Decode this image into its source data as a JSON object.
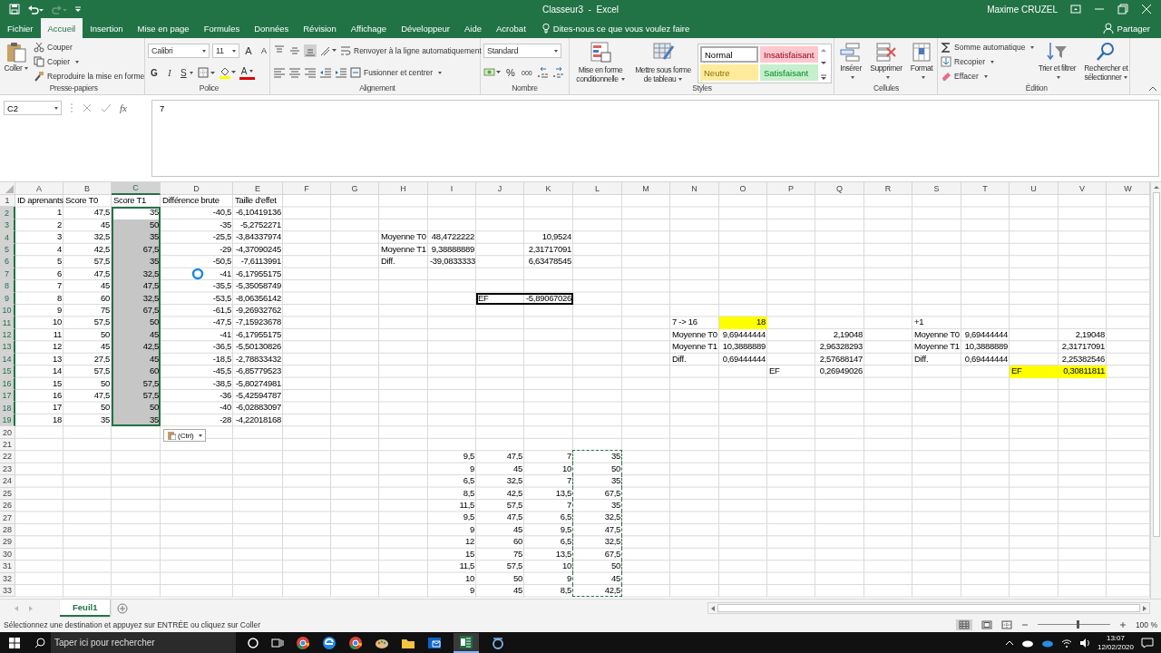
{
  "title_bar": {
    "title": "Classeur3  -  Excel",
    "user": "Maxime CRUZEL"
  },
  "ribbon_tabs": [
    {
      "label": "Fichier",
      "selected": false
    },
    {
      "label": "Accueil",
      "selected": true
    },
    {
      "label": "Insertion",
      "selected": false
    },
    {
      "label": "Mise en page",
      "selected": false
    },
    {
      "label": "Formules",
      "selected": false
    },
    {
      "label": "Données",
      "selected": false
    },
    {
      "label": "Révision",
      "selected": false
    },
    {
      "label": "Affichage",
      "selected": false
    },
    {
      "label": "Développeur",
      "selected": false
    },
    {
      "label": "Aide",
      "selected": false
    },
    {
      "label": "Acrobat",
      "selected": false
    }
  ],
  "tell_me": "Dites-nous ce que vous voulez faire",
  "share": "Partager",
  "ribbon_groups": [
    {
      "label": "Presse-papiers",
      "texts": [
        "Coller",
        "Couper",
        "Copier",
        "Reproduire la mise en forme"
      ]
    },
    {
      "label": "Police",
      "texts": [
        "Calibri",
        "11",
        "A",
        "A",
        "G",
        "I",
        "S",
        "A"
      ]
    },
    {
      "label": "Alignement",
      "texts": [
        "Renvoyer à la ligne automatiquement",
        "Fusionner et centrer"
      ]
    },
    {
      "label": "Nombre",
      "texts": [
        "Standard",
        "%",
        "000"
      ]
    },
    {
      "label": "Styles",
      "texts": [
        "Mise en forme conditionnelle",
        "Mettre sous forme de tableau"
      ],
      "styles": [
        {
          "label": "Normal",
          "color": "#ffffff",
          "selected": true
        },
        {
          "label": "Insatisfaisant",
          "color": "#ffc7ce",
          "selected": false
        },
        {
          "label": "Neutre",
          "color": "#ffeb9c",
          "selected": false
        },
        {
          "label": "Satisfaisant",
          "color": "#c6efce",
          "selected": false
        }
      ]
    },
    {
      "label": "Cellules",
      "texts": [
        "Insérer",
        "Supprimer",
        "Format"
      ]
    },
    {
      "label": "Édition",
      "texts": [
        "Somme automatique",
        "Recopier",
        "Effacer",
        "Trier et filtrer",
        "Rechercher et sélectionner"
      ]
    }
  ],
  "formula_bar": {
    "name_box": "C2",
    "function_label": "fx",
    "value": "7"
  },
  "sheet": {
    "columns": [
      "A",
      "B",
      "C",
      "D",
      "E",
      "F",
      "G",
      "H",
      "I",
      "J",
      "K",
      "L",
      "M",
      "N",
      "O",
      "P",
      "Q",
      "R",
      "S",
      "T",
      "U",
      "V",
      "W"
    ],
    "rows": [
      {
        "number": "1",
        "cells": {
          "A": {
            "text": "ID aprenants",
            "kind": "text",
            "selected": false
          },
          "B": {
            "text": "Score T0",
            "kind": "text",
            "selected": false
          },
          "C": {
            "text": "Score T1",
            "kind": "text",
            "selected": false
          },
          "D": {
            "text": "Différence brute",
            "kind": "text",
            "selected": false
          },
          "E": {
            "text": "Taille d'effet",
            "kind": "text",
            "selected": false
          }
        }
      },
      {
        "number": "2",
        "cells": {
          "A": {
            "text": "1",
            "kind": "number",
            "selected": false
          },
          "B": {
            "text": "47,5",
            "kind": "number",
            "selected": false
          },
          "C": {
            "text": "35",
            "kind": "number",
            "selected": true,
            "active": true
          },
          "D": {
            "text": "-40,5",
            "kind": "number",
            "selected": false
          },
          "E": {
            "text": "-6,10419136",
            "kind": "number",
            "selected": false
          }
        }
      },
      {
        "number": "3",
        "cells": {
          "A": {
            "text": "2",
            "kind": "number",
            "selected": false
          },
          "B": {
            "text": "45",
            "kind": "number",
            "selected": false
          },
          "C": {
            "text": "50",
            "kind": "number",
            "selected": true
          },
          "D": {
            "text": "-35",
            "kind": "number",
            "selected": false
          },
          "E": {
            "text": "-5,2752271",
            "kind": "number",
            "selected": false
          }
        }
      },
      {
        "number": "4",
        "cells": {
          "A": {
            "text": "3",
            "kind": "number",
            "selected": false
          },
          "B": {
            "text": "32,5",
            "kind": "number",
            "selected": false
          },
          "C": {
            "text": "35",
            "kind": "number",
            "selected": true
          },
          "D": {
            "text": "-25,5",
            "kind": "number",
            "selected": false
          },
          "E": {
            "text": "-3,84337974",
            "kind": "number",
            "selected": false
          },
          "H": {
            "text": "Moyenne T0",
            "kind": "text",
            "selected": false
          },
          "I": {
            "text": "48,4722222",
            "kind": "number",
            "selected": false
          },
          "K": {
            "text": "10,9524",
            "kind": "number",
            "selected": false
          }
        }
      },
      {
        "number": "5",
        "cells": {
          "A": {
            "text": "4",
            "kind": "number",
            "selected": false
          },
          "B": {
            "text": "42,5",
            "kind": "number",
            "selected": false
          },
          "C": {
            "text": "67,5",
            "kind": "number",
            "selected": true
          },
          "D": {
            "text": "-29",
            "kind": "number",
            "selected": false
          },
          "E": {
            "text": "-4,37090245",
            "kind": "number",
            "selected": false
          },
          "H": {
            "text": "Moyenne T1",
            "kind": "text",
            "selected": false
          },
          "I": {
            "text": "9,38888889",
            "kind": "number",
            "selected": false
          },
          "K": {
            "text": "2,31717091",
            "kind": "number",
            "selected": false
          }
        }
      },
      {
        "number": "6",
        "cells": {
          "A": {
            "text": "5",
            "kind": "number",
            "selected": false
          },
          "B": {
            "text": "57,5",
            "kind": "number",
            "selected": false
          },
          "C": {
            "text": "35",
            "kind": "number",
            "selected": true
          },
          "D": {
            "text": "-50,5",
            "kind": "number",
            "selected": false
          },
          "E": {
            "text": "-7,6113991",
            "kind": "number",
            "selected": false
          },
          "H": {
            "text": "Diff.",
            "kind": "text",
            "selected": false
          },
          "I": {
            "text": "-39,0833333",
            "kind": "number",
            "selected": false
          },
          "K": {
            "text": "6,63478545",
            "kind": "number",
            "selected": false
          }
        }
      },
      {
        "number": "7",
        "cells": {
          "A": {
            "text": "6",
            "kind": "number",
            "selected": false
          },
          "B": {
            "text": "47,5",
            "kind": "number",
            "selected": false
          },
          "C": {
            "text": "32,5",
            "kind": "number",
            "selected": true
          },
          "D": {
            "text": "-41",
            "kind": "number",
            "selected": false
          },
          "E": {
            "text": "-6,17955175",
            "kind": "number",
            "selected": false
          }
        }
      },
      {
        "number": "8",
        "cells": {
          "A": {
            "text": "7",
            "kind": "number",
            "selected": false
          },
          "B": {
            "text": "45",
            "kind": "number",
            "selected": false
          },
          "C": {
            "text": "47,5",
            "kind": "number",
            "selected": true
          },
          "D": {
            "text": "-35,5",
            "kind": "number",
            "selected": false
          },
          "E": {
            "text": "-5,35058749",
            "kind": "number",
            "selected": false
          }
        }
      },
      {
        "number": "9",
        "cells": {
          "A": {
            "text": "8",
            "kind": "number",
            "selected": false
          },
          "B": {
            "text": "60",
            "kind": "number",
            "selected": false
          },
          "C": {
            "text": "32,5",
            "kind": "number",
            "selected": true
          },
          "D": {
            "text": "-53,5",
            "kind": "number",
            "selected": false
          },
          "E": {
            "text": "-8,06356142",
            "kind": "number",
            "selected": false
          },
          "J": {
            "text": "EF",
            "kind": "text",
            "selected": false,
            "outlined": true
          },
          "K": {
            "text": "-5,89067026",
            "kind": "number",
            "selected": false,
            "outlined": true
          }
        }
      },
      {
        "number": "10",
        "cells": {
          "A": {
            "text": "9",
            "kind": "number",
            "selected": false
          },
          "B": {
            "text": "75",
            "kind": "number",
            "selected": false
          },
          "C": {
            "text": "67,5",
            "kind": "number",
            "selected": true
          },
          "D": {
            "text": "-61,5",
            "kind": "number",
            "selected": false
          },
          "E": {
            "text": "-9,26932762",
            "kind": "number",
            "selected": false
          }
        }
      },
      {
        "number": "11",
        "cells": {
          "A": {
            "text": "10",
            "kind": "number",
            "selected": false
          },
          "B": {
            "text": "57,5",
            "kind": "number",
            "selected": false
          },
          "C": {
            "text": "50",
            "kind": "number",
            "selected": true
          },
          "D": {
            "text": "-47,5",
            "kind": "number",
            "selected": false
          },
          "E": {
            "text": "-7,15923678",
            "kind": "number",
            "selected": false
          },
          "N": {
            "text": "7 -> 16",
            "kind": "text",
            "selected": false
          },
          "O": {
            "text": "18",
            "kind": "number",
            "selected": false,
            "color": "#ffff00"
          },
          "S": {
            "text": "+1",
            "kind": "text",
            "selected": false
          }
        }
      },
      {
        "number": "12",
        "cells": {
          "A": {
            "text": "11",
            "kind": "number",
            "selected": false
          },
          "B": {
            "text": "50",
            "kind": "number",
            "selected": false
          },
          "C": {
            "text": "45",
            "kind": "number",
            "selected": true
          },
          "D": {
            "text": "-41",
            "kind": "number",
            "selected": false
          },
          "E": {
            "text": "-6,17955175",
            "kind": "number",
            "selected": false
          },
          "N": {
            "text": "Moyenne T0",
            "kind": "text",
            "selected": false
          },
          "O": {
            "text": "9,69444444",
            "kind": "number",
            "selected": false
          },
          "Q": {
            "text": "2,19048",
            "kind": "number",
            "selected": false
          },
          "S": {
            "text": "Moyenne T0",
            "kind": "text",
            "selected": false
          },
          "T": {
            "text": "9,69444444",
            "kind": "number",
            "selected": false
          },
          "V": {
            "text": "2,19048",
            "kind": "number",
            "selected": false
          }
        }
      },
      {
        "number": "13",
        "cells": {
          "A": {
            "text": "12",
            "kind": "number",
            "selected": false
          },
          "B": {
            "text": "45",
            "kind": "number",
            "selected": false
          },
          "C": {
            "text": "42,5",
            "kind": "number",
            "selected": true
          },
          "D": {
            "text": "-36,5",
            "kind": "number",
            "selected": false
          },
          "E": {
            "text": "-5,50130826",
            "kind": "number",
            "selected": false
          },
          "N": {
            "text": "Moyenne T1",
            "kind": "text",
            "selected": false
          },
          "O": {
            "text": "10,3888889",
            "kind": "number",
            "selected": false
          },
          "Q": {
            "text": "2,96328293",
            "kind": "number",
            "selected": false
          },
          "S": {
            "text": "Moyenne T1",
            "kind": "text",
            "selected": false
          },
          "T": {
            "text": "10,3888889",
            "kind": "number",
            "selected": false
          },
          "V": {
            "text": "2,31717091",
            "kind": "number",
            "selected": false
          }
        }
      },
      {
        "number": "14",
        "cells": {
          "A": {
            "text": "13",
            "kind": "number",
            "selected": false
          },
          "B": {
            "text": "27,5",
            "kind": "number",
            "selected": false
          },
          "C": {
            "text": "45",
            "kind": "number",
            "selected": true
          },
          "D": {
            "text": "-18,5",
            "kind": "number",
            "selected": false
          },
          "E": {
            "text": "-2,78833432",
            "kind": "number",
            "selected": false
          },
          "N": {
            "text": "Diff.",
            "kind": "text",
            "selected": false
          },
          "O": {
            "text": "0,69444444",
            "kind": "number",
            "selected": false
          },
          "Q": {
            "text": "2,57688147",
            "kind": "number",
            "selected": false
          },
          "S": {
            "text": "Diff.",
            "kind": "text",
            "selected": false
          },
          "T": {
            "text": "0,69444444",
            "kind": "number",
            "selected": false
          },
          "V": {
            "text": "2,25382546",
            "kind": "number",
            "selected": false
          }
        }
      },
      {
        "number": "15",
        "cells": {
          "A": {
            "text": "14",
            "kind": "number",
            "selected": false
          },
          "B": {
            "text": "57,5",
            "kind": "number",
            "selected": false
          },
          "C": {
            "text": "60",
            "kind": "number",
            "selected": true
          },
          "D": {
            "text": "-45,5",
            "kind": "number",
            "selected": false
          },
          "E": {
            "text": "-6,85779523",
            "kind": "number",
            "selected": false
          },
          "P": {
            "text": "EF",
            "kind": "text",
            "selected": false
          },
          "Q": {
            "text": "0,26949026",
            "kind": "number",
            "selected": false
          },
          "U": {
            "text": "EF",
            "kind": "text",
            "selected": false,
            "color": "#ffff00"
          },
          "V": {
            "text": "0,30811811",
            "kind": "number",
            "selected": false,
            "color": "#ffff00"
          }
        }
      },
      {
        "number": "16",
        "cells": {
          "A": {
            "text": "15",
            "kind": "number",
            "selected": false
          },
          "B": {
            "text": "50",
            "kind": "number",
            "selected": false
          },
          "C": {
            "text": "57,5",
            "kind": "number",
            "selected": true
          },
          "D": {
            "text": "-38,5",
            "kind": "number",
            "selected": false
          },
          "E": {
            "text": "-5,80274981",
            "kind": "number",
            "selected": false
          }
        }
      },
      {
        "number": "17",
        "cells": {
          "A": {
            "text": "16",
            "kind": "number",
            "selected": false
          },
          "B": {
            "text": "47,5",
            "kind": "number",
            "selected": false
          },
          "C": {
            "text": "57,5",
            "kind": "number",
            "selected": true
          },
          "D": {
            "text": "-36",
            "kind": "number",
            "selected": false
          },
          "E": {
            "text": "-5,42594787",
            "kind": "number",
            "selected": false
          }
        }
      },
      {
        "number": "18",
        "cells": {
          "A": {
            "text": "17",
            "kind": "number",
            "selected": false
          },
          "B": {
            "text": "50",
            "kind": "number",
            "selected": false
          },
          "C": {
            "text": "50",
            "kind": "number",
            "selected": true
          },
          "D": {
            "text": "-40",
            "kind": "number",
            "selected": false
          },
          "E": {
            "text": "-6,02883097",
            "kind": "number",
            "selected": false
          }
        }
      },
      {
        "number": "19",
        "cells": {
          "A": {
            "text": "18",
            "kind": "number",
            "selected": false
          },
          "B": {
            "text": "35",
            "kind": "number",
            "selected": false
          },
          "C": {
            "text": "35",
            "kind": "number",
            "selected": true
          },
          "D": {
            "text": "-28",
            "kind": "number",
            "selected": false
          },
          "E": {
            "text": "-4,22018168",
            "kind": "number",
            "selected": false
          }
        }
      },
      {
        "number": "20"
      },
      {
        "number": "21"
      },
      {
        "number": "22",
        "cells": {
          "I": {
            "text": "9,5",
            "kind": "number",
            "selected": false
          },
          "J": {
            "text": "47,5",
            "kind": "number",
            "selected": false
          },
          "K": {
            "text": "7",
            "kind": "number",
            "selected": false
          },
          "L": {
            "text": "35",
            "kind": "number",
            "selected": false,
            "copied": true
          }
        }
      },
      {
        "number": "23",
        "cells": {
          "I": {
            "text": "9",
            "kind": "number",
            "selected": false
          },
          "J": {
            "text": "45",
            "kind": "number",
            "selected": false
          },
          "K": {
            "text": "10",
            "kind": "number",
            "selected": false
          },
          "L": {
            "text": "50",
            "kind": "number",
            "selected": false,
            "copied": true
          }
        }
      },
      {
        "number": "24",
        "cells": {
          "I": {
            "text": "6,5",
            "kind": "number",
            "selected": false
          },
          "J": {
            "text": "32,5",
            "kind": "number",
            "selected": false
          },
          "K": {
            "text": "7",
            "kind": "number",
            "selected": false
          },
          "L": {
            "text": "35",
            "kind": "number",
            "selected": false,
            "copied": true
          }
        }
      },
      {
        "number": "25",
        "cells": {
          "I": {
            "text": "8,5",
            "kind": "number",
            "selected": false
          },
          "J": {
            "text": "42,5",
            "kind": "number",
            "selected": false
          },
          "K": {
            "text": "13,5",
            "kind": "number",
            "selected": false
          },
          "L": {
            "text": "67,5",
            "kind": "number",
            "selected": false,
            "copied": true
          }
        }
      },
      {
        "number": "26",
        "cells": {
          "I": {
            "text": "11,5",
            "kind": "number",
            "selected": false
          },
          "J": {
            "text": "57,5",
            "kind": "number",
            "selected": false
          },
          "K": {
            "text": "7",
            "kind": "number",
            "selected": false
          },
          "L": {
            "text": "35",
            "kind": "number",
            "selected": false,
            "copied": true
          }
        }
      },
      {
        "number": "27",
        "cells": {
          "I": {
            "text": "9,5",
            "kind": "number",
            "selected": false
          },
          "J": {
            "text": "47,5",
            "kind": "number",
            "selected": false
          },
          "K": {
            "text": "6,5",
            "kind": "number",
            "selected": false
          },
          "L": {
            "text": "32,5",
            "kind": "number",
            "selected": false,
            "copied": true
          }
        }
      },
      {
        "number": "28",
        "cells": {
          "I": {
            "text": "9",
            "kind": "number",
            "selected": false
          },
          "J": {
            "text": "45",
            "kind": "number",
            "selected": false
          },
          "K": {
            "text": "9,5",
            "kind": "number",
            "selected": false
          },
          "L": {
            "text": "47,5",
            "kind": "number",
            "selected": false,
            "copied": true
          }
        }
      },
      {
        "number": "29",
        "cells": {
          "I": {
            "text": "12",
            "kind": "number",
            "selected": false
          },
          "J": {
            "text": "60",
            "kind": "number",
            "selected": false
          },
          "K": {
            "text": "6,5",
            "kind": "number",
            "selected": false
          },
          "L": {
            "text": "32,5",
            "kind": "number",
            "selected": false,
            "copied": true
          }
        }
      },
      {
        "number": "30",
        "cells": {
          "I": {
            "text": "15",
            "kind": "number",
            "selected": false
          },
          "J": {
            "text": "75",
            "kind": "number",
            "selected": false
          },
          "K": {
            "text": "13,5",
            "kind": "number",
            "selected": false
          },
          "L": {
            "text": "67,5",
            "kind": "number",
            "selected": false,
            "copied": true
          }
        }
      },
      {
        "number": "31",
        "cells": {
          "I": {
            "text": "11,5",
            "kind": "number",
            "selected": false
          },
          "J": {
            "text": "57,5",
            "kind": "number",
            "selected": false
          },
          "K": {
            "text": "10",
            "kind": "number",
            "selected": false
          },
          "L": {
            "text": "50",
            "kind": "number",
            "selected": false,
            "copied": true
          }
        }
      },
      {
        "number": "32",
        "cells": {
          "I": {
            "text": "10",
            "kind": "number",
            "selected": false
          },
          "J": {
            "text": "50",
            "kind": "number",
            "selected": false
          },
          "K": {
            "text": "9",
            "kind": "number",
            "selected": false
          },
          "L": {
            "text": "45",
            "kind": "number",
            "selected": false,
            "copied": true
          }
        }
      },
      {
        "number": "33",
        "cells": {
          "I": {
            "text": "9",
            "kind": "number",
            "selected": false
          },
          "J": {
            "text": "45",
            "kind": "number",
            "selected": false
          },
          "K": {
            "text": "8,5",
            "kind": "number",
            "selected": false
          },
          "L": {
            "text": "42,5",
            "kind": "number",
            "selected": false,
            "copied": true
          }
        }
      }
    ]
  },
  "paste_options": {
    "label": "(Ctrl)"
  },
  "sheet_tabs": [
    {
      "label": "Feuil1",
      "selected": true
    }
  ],
  "status_bar": {
    "message": "Sélectionnez une destination et appuyez sur ENTRÉE ou cliquez sur Coller",
    "zoom": {
      "level": 0.55,
      "reading": "100 %"
    }
  },
  "taskbar": {
    "search_placeholder": "Taper ici pour rechercher",
    "time": "13:07",
    "date": "12/02/2020"
  }
}
